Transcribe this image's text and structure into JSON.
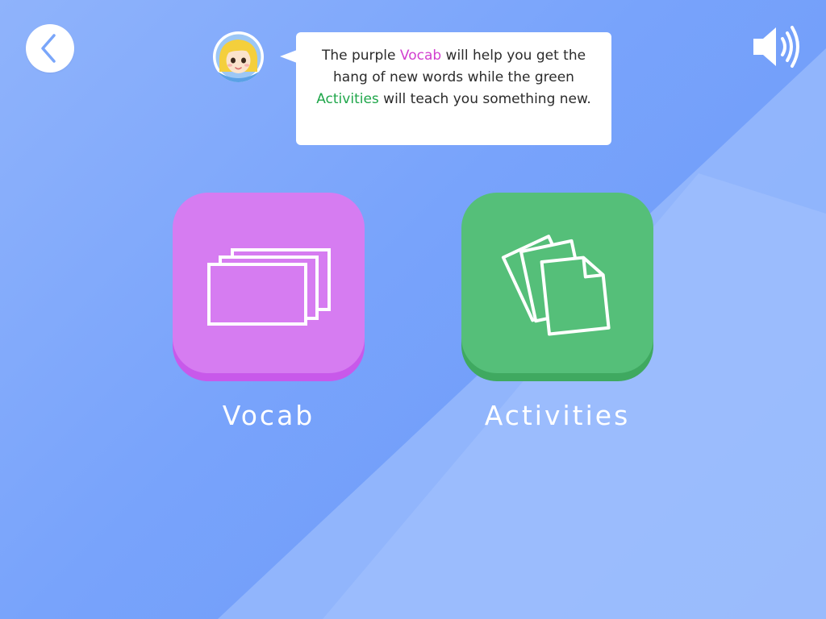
{
  "header": {
    "back_icon": "chevron-left-icon",
    "sound_icon": "speaker-volume-icon",
    "avatar_icon": "girl-avatar-icon"
  },
  "bubble": {
    "part1": "The purple ",
    "vocab_word": "Vocab",
    "part2": " will help you get the hang of new words while the green ",
    "activities_word": "Activities",
    "part3": " will teach you something new."
  },
  "tiles": [
    {
      "label": "Vocab",
      "icon": "flashcards-icon",
      "color": "#d67cf1"
    },
    {
      "label": "Activities",
      "icon": "papers-icon",
      "color": "#55bf79"
    }
  ],
  "colors": {
    "background": "#78a3fb",
    "vocab_accent": "#d23fcf",
    "activities_accent": "#1fa64a"
  }
}
